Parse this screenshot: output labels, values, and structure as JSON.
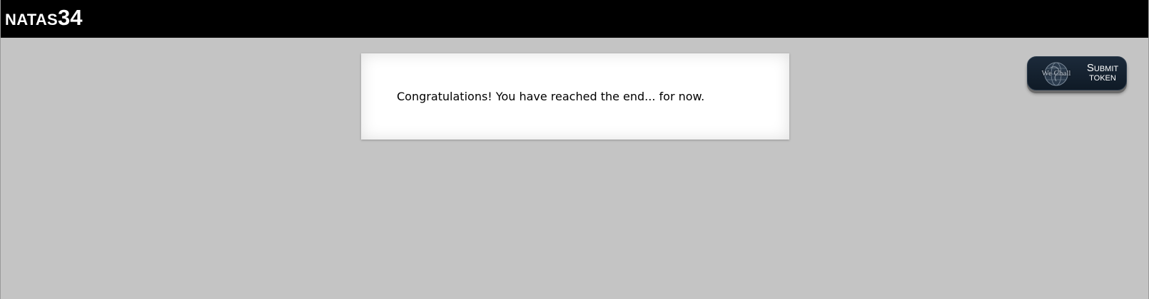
{
  "header": {
    "title_main": "NATAS",
    "title_level": "34"
  },
  "content": {
    "message": "Congratulations! You have reached the end... for now."
  },
  "submit_token": {
    "logo_text": "We Chall",
    "label_submit": "Submit",
    "label_token": "token",
    "logo_icon": "globe-icon"
  },
  "colors": {
    "header_background": "#000000",
    "page_background": "#c4c4c4",
    "content_background": "#ffffff",
    "button_background": "#152231"
  }
}
